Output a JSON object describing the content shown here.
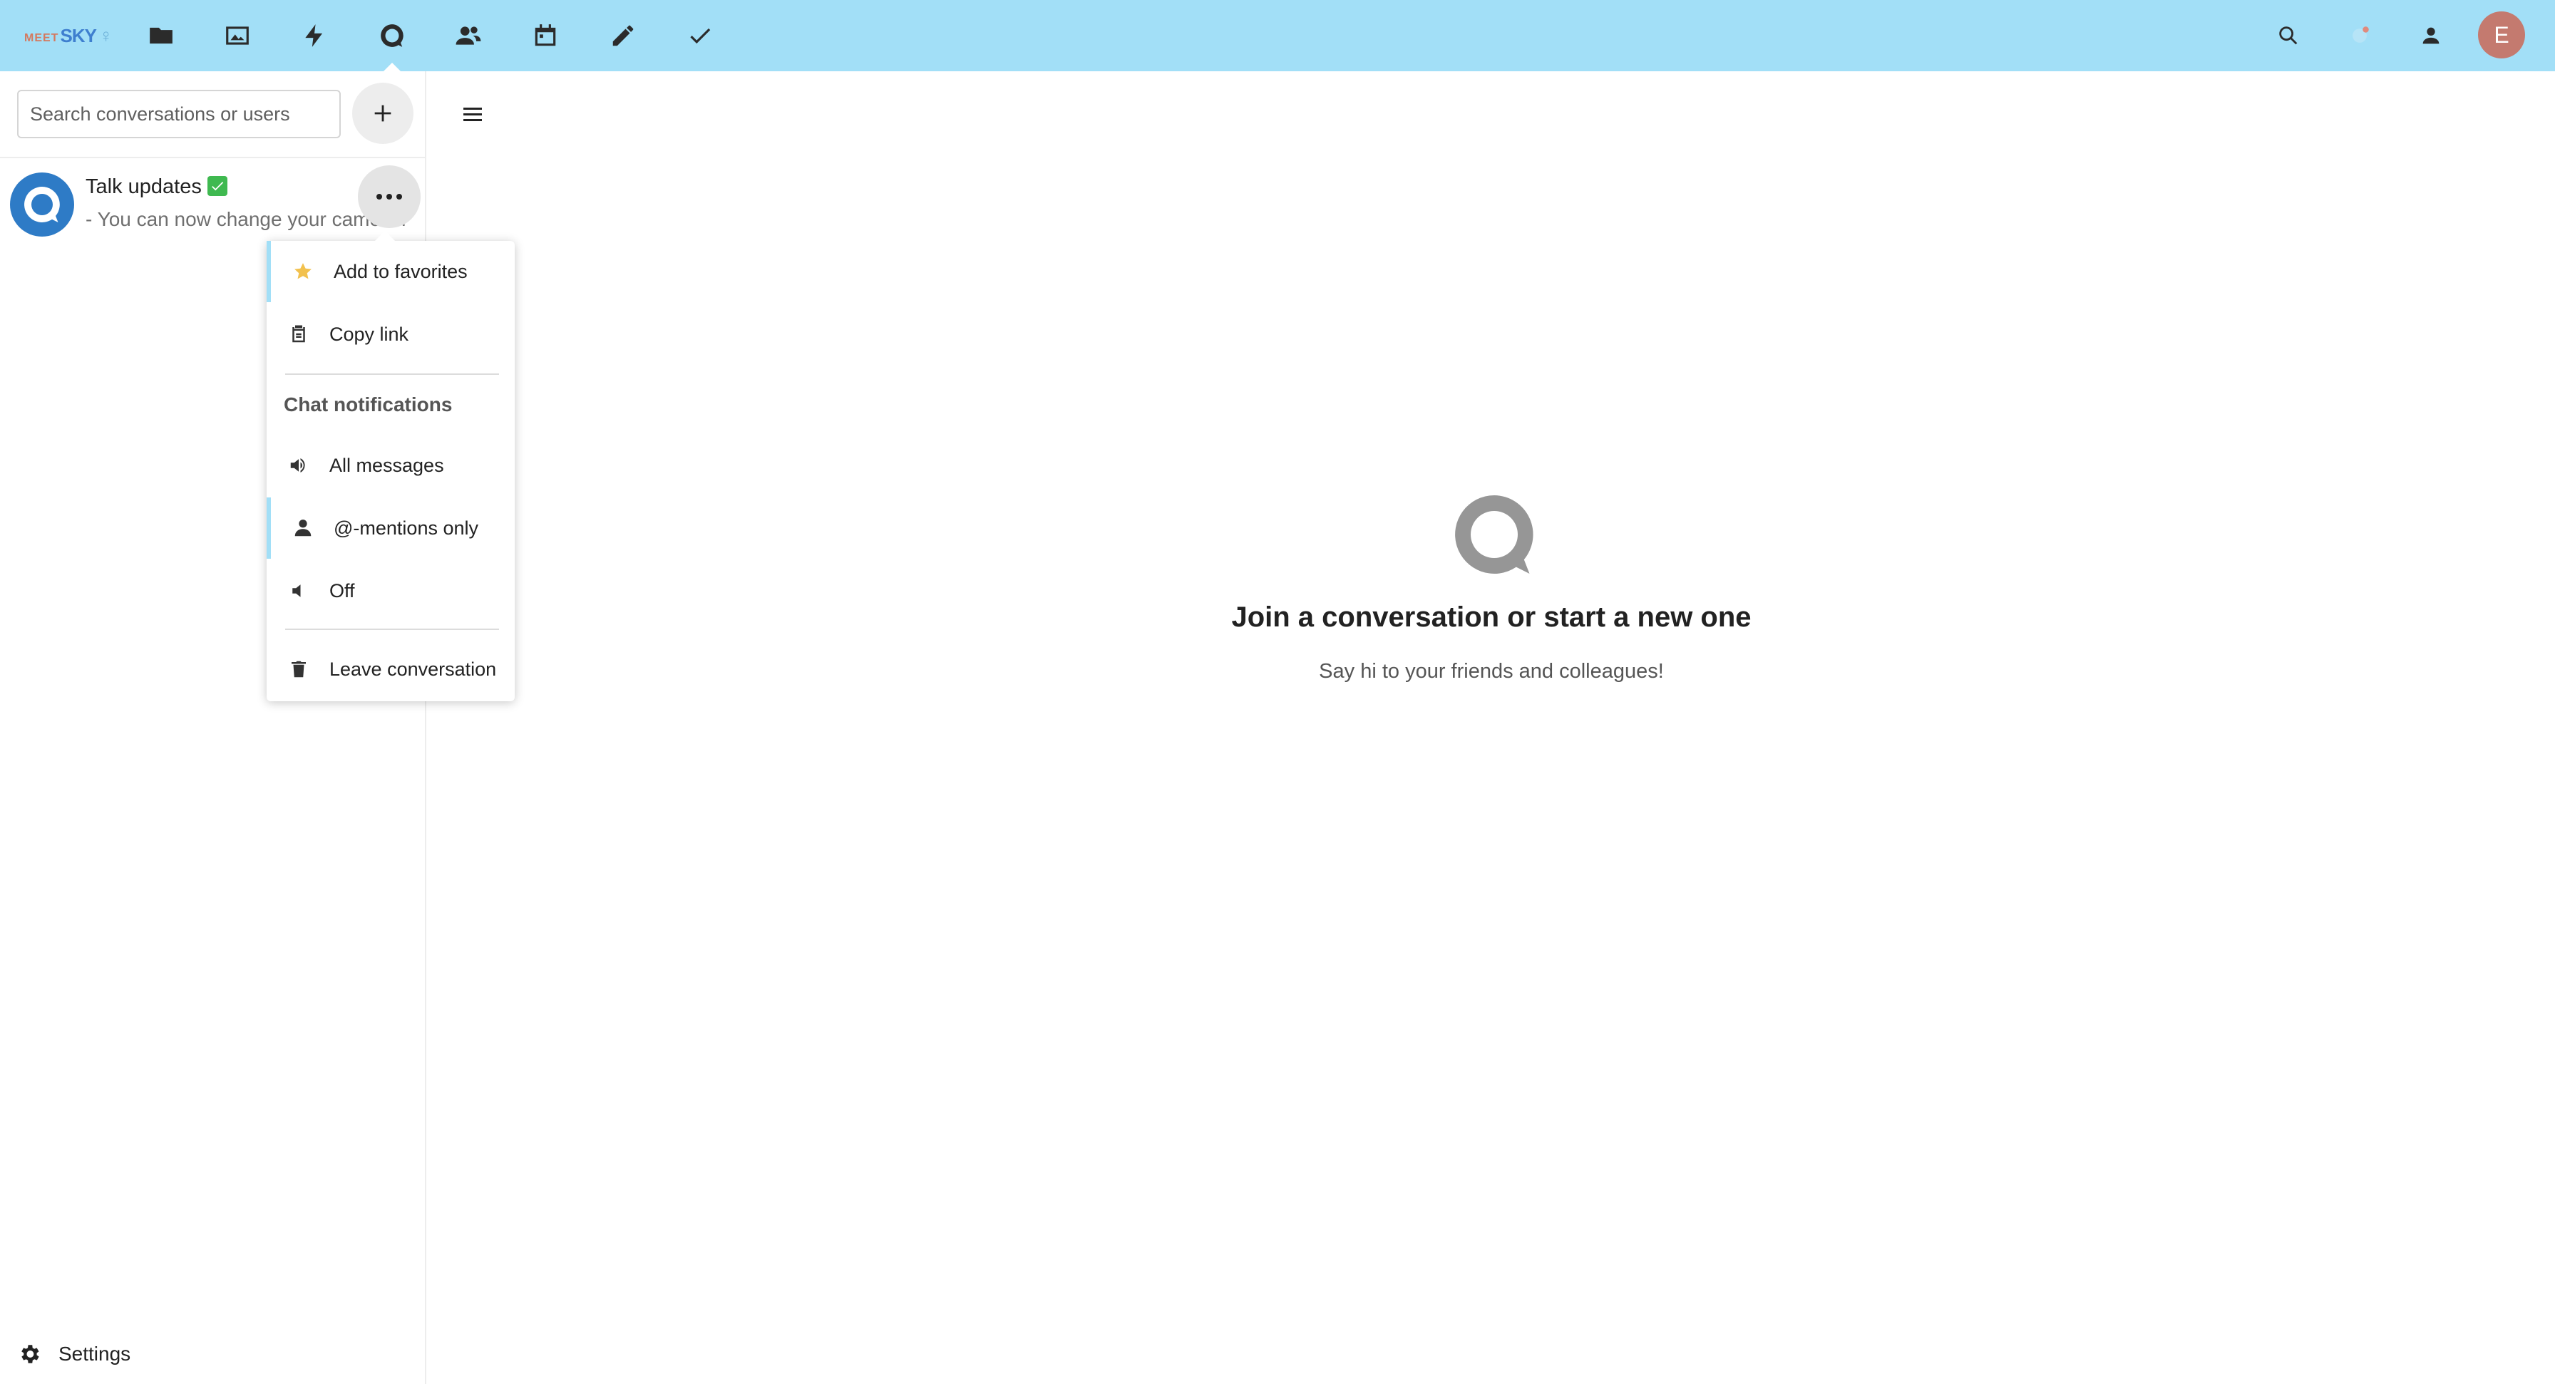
{
  "header": {
    "logo": {
      "part1": "MEET",
      "part2": "SKY",
      "part3": "♀"
    },
    "apps": [
      {
        "name": "files-icon",
        "label": "Files"
      },
      {
        "name": "photos-icon",
        "label": "Photos"
      },
      {
        "name": "activity-icon",
        "label": "Activity"
      },
      {
        "name": "talk-icon",
        "label": "Talk",
        "active": true
      },
      {
        "name": "contacts-icon",
        "label": "Contacts"
      },
      {
        "name": "calendar-icon",
        "label": "Calendar"
      },
      {
        "name": "notes-icon",
        "label": "Notes"
      },
      {
        "name": "tasks-icon",
        "label": "Tasks"
      }
    ],
    "right_icons": [
      "search-icon",
      "notifications-icon",
      "contacts-menu-icon"
    ],
    "avatar_initial": "E",
    "colors": {
      "header_bg": "#a2dff7",
      "avatar_bg": "#c47a6f"
    }
  },
  "sidebar": {
    "search_placeholder": "Search conversations or users",
    "add_button_icon": "plus-icon",
    "conversations": [
      {
        "title": "Talk updates",
        "badge": "✅",
        "last_message": "- You can now change your camera while in a call..."
      }
    ],
    "settings_label": "Settings"
  },
  "menu": {
    "items": [
      {
        "icon": "star-icon",
        "label": "Add to favorites"
      },
      {
        "icon": "clipboard-icon",
        "label": "Copy link"
      }
    ],
    "notifications_caption": "Chat notifications",
    "notification_options": [
      {
        "icon": "sound-icon",
        "label": "All messages",
        "selected": false
      },
      {
        "icon": "user-icon",
        "label": "@-mentions only",
        "selected": true
      },
      {
        "icon": "mute-icon",
        "label": "Off",
        "selected": false
      }
    ],
    "leave": {
      "icon": "trash-icon",
      "label": "Leave conversation"
    }
  },
  "main": {
    "empty_title": "Join a conversation or start a new one",
    "empty_subtitle": "Say hi to your friends and colleagues!"
  }
}
